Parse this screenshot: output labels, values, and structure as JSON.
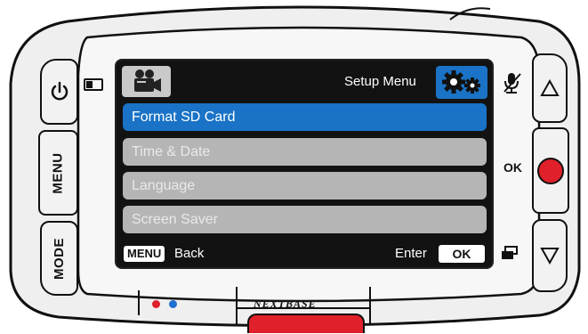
{
  "device": {
    "brand": "NEXTBASE",
    "left_buttons": {
      "menu_label": "MENU",
      "mode_label": "MODE"
    },
    "right_buttons": {
      "ok_label": "OK"
    },
    "led_colors": {
      "red": "#e0202a",
      "blue": "#1f6fd0"
    },
    "accent_red": "#e0202a"
  },
  "screen": {
    "title": "Setup Menu",
    "left_icon": "video-camera-icon",
    "right_icon": "gears-icon",
    "items": [
      {
        "label": "Format SD Card",
        "selected": true
      },
      {
        "label": "Time & Date",
        "selected": false
      },
      {
        "label": "Language",
        "selected": false
      },
      {
        "label": "Screen Saver",
        "selected": false
      }
    ],
    "footer": {
      "menu_key": "MENU",
      "back_label": "Back",
      "enter_label": "Enter",
      "ok_key": "OK"
    },
    "highlight_color": "#1a73c6"
  }
}
